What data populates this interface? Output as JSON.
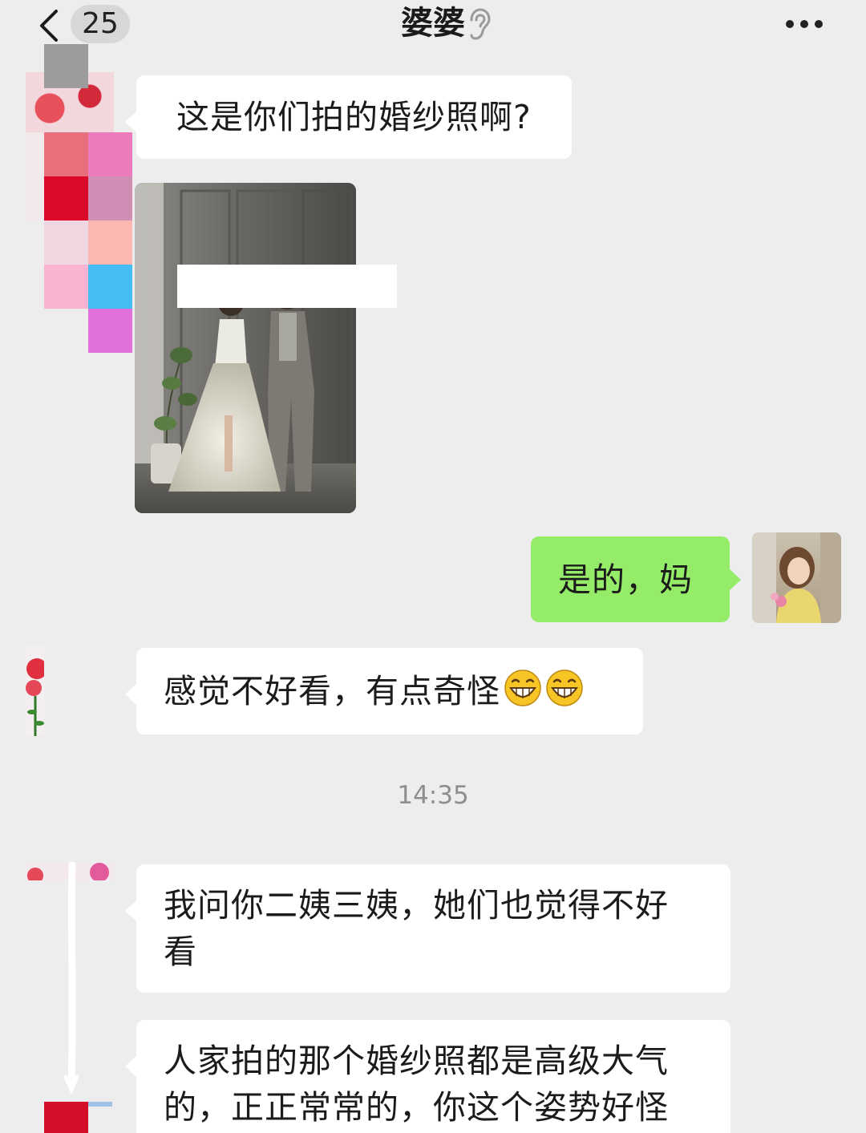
{
  "header": {
    "unread_count": "25",
    "title": "婆婆",
    "back_icon": "chevron-left-icon",
    "mute_icon": "ear-icon",
    "more_icon": "more-dots-icon"
  },
  "messages": [
    {
      "sender": "婆婆",
      "side": "left",
      "type": "text",
      "text": "这是你们拍的婚纱照啊?"
    },
    {
      "sender": "婆婆",
      "side": "left",
      "type": "image"
    },
    {
      "sender": "me",
      "side": "right",
      "type": "text",
      "text": "是的，妈"
    },
    {
      "sender": "婆婆",
      "side": "left",
      "type": "text",
      "text": "感觉不好看，有点奇怪",
      "emoji": [
        "grin-emoji",
        "grin-emoji"
      ]
    },
    {
      "type": "timestamp",
      "text": "14:35"
    },
    {
      "sender": "婆婆",
      "side": "left",
      "type": "text",
      "lines": [
        "我问你二姨三姨，她们也觉得不好",
        "看"
      ]
    },
    {
      "sender": "婆婆",
      "side": "left",
      "type": "text",
      "lines": [
        "人家拍的那个婚纱照都是高级大气",
        "的，正正常常的，你这个姿势好怪"
      ]
    }
  ],
  "colors": {
    "background": "#ededed",
    "incoming_bubble": "#ffffff",
    "outgoing_bubble": "#95ec69"
  }
}
